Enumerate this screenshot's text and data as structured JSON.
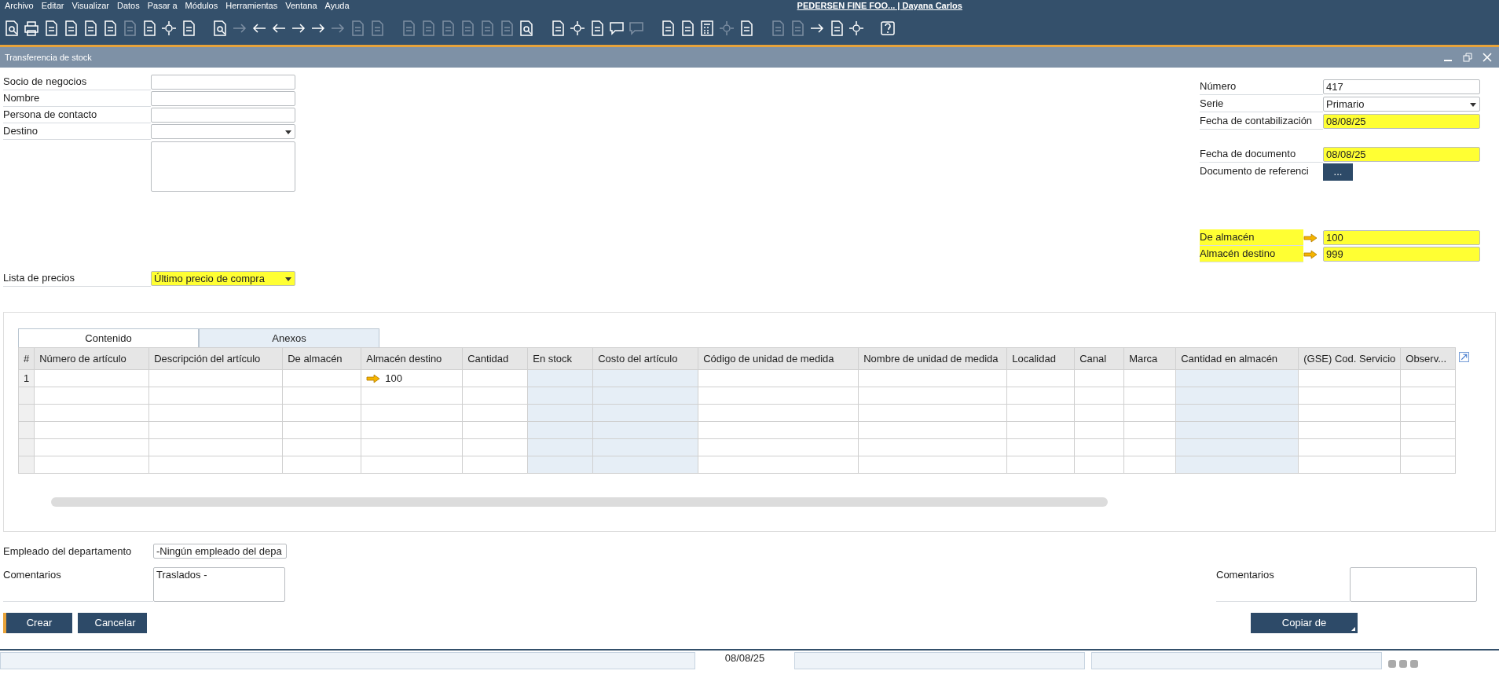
{
  "menu": [
    "Archivo",
    "Editar",
    "Visualizar",
    "Datos",
    "Pasar a",
    "Módulos",
    "Herramientas",
    "Ventana",
    "Ayuda"
  ],
  "app_title": "PEDERSEN FINE FOO... | Dayana Carlos",
  "toolbar": [
    {
      "disabled": false
    },
    {
      "disabled": false
    },
    {
      "disabled": false
    },
    {
      "disabled": false
    },
    {
      "disabled": false
    },
    {
      "disabled": false
    },
    {
      "disabled": true
    },
    {
      "disabled": false
    },
    {
      "disabled": false
    },
    {
      "disabled": false
    },
    {
      "disabled": false
    },
    {
      "disabled": true
    },
    {
      "disabled": false
    },
    {
      "disabled": false
    },
    {
      "disabled": false
    },
    {
      "disabled": false
    },
    {
      "disabled": true
    },
    {
      "disabled": true
    },
    {
      "disabled": true
    },
    {
      "disabled": true
    },
    {
      "disabled": true
    },
    {
      "disabled": true
    },
    {
      "disabled": true
    },
    {
      "disabled": true
    },
    {
      "disabled": true
    },
    {
      "disabled": false
    },
    {
      "disabled": false
    },
    {
      "disabled": false
    },
    {
      "disabled": false
    },
    {
      "disabled": false
    },
    {
      "disabled": true
    },
    {
      "disabled": false
    },
    {
      "disabled": false
    },
    {
      "disabled": false
    },
    {
      "disabled": true
    },
    {
      "disabled": false
    },
    {
      "disabled": true
    },
    {
      "disabled": true
    },
    {
      "disabled": false
    },
    {
      "disabled": false
    },
    {
      "disabled": false
    },
    {
      "disabled": false
    }
  ],
  "window": {
    "title": "Transferencia de stock"
  },
  "left_fields": [
    {
      "kind": "text",
      "label": "Socio de negocios"
    },
    {
      "kind": "text",
      "label": "Nombre"
    },
    {
      "kind": "text",
      "label": "Persona de contacto"
    },
    {
      "kind": "select",
      "label": "Destino"
    },
    {
      "kind": "textarea"
    }
  ],
  "price_list": {
    "label": "Lista de precios",
    "value": "Último precio de compra",
    "highlighted": true
  },
  "right_fields": [
    {
      "kind": "text",
      "label": "Número",
      "value": "417",
      "highlighted": false
    },
    {
      "kind": "select",
      "label": "Serie",
      "value": "Primario",
      "highlighted": false
    },
    {
      "kind": "text",
      "label": "Fecha de contabilización",
      "value": "08/08/25",
      "highlighted": true
    },
    {
      "kind": "gap"
    },
    {
      "kind": "text",
      "label": "Fecha de documento",
      "value": "08/08/25",
      "highlighted": true
    },
    {
      "kind": "button",
      "label": "Documento de referenci",
      "button": "..."
    }
  ],
  "warehouses": [
    {
      "label": "De almacén",
      "value": "100",
      "highlighted": true
    },
    {
      "label": "Almacén destino",
      "value": "999",
      "highlighted": true
    }
  ],
  "tabs": [
    {
      "label": "Contenido",
      "selected": true
    },
    {
      "label": "Anexos",
      "selected": false
    }
  ],
  "table": {
    "columns": [
      {
        "label": "#"
      },
      {
        "label": "Número de artículo",
        "shaded": false
      },
      {
        "label": "Descripción del artículo",
        "shaded": false
      },
      {
        "label": "De almacén",
        "shaded": false
      },
      {
        "label": "Almacén destino",
        "shaded": false
      },
      {
        "label": "Cantidad",
        "shaded": false
      },
      {
        "label": "En stock",
        "shaded": true
      },
      {
        "label": "Costo del artículo",
        "shaded": true
      },
      {
        "label": "Código de unidad de medida",
        "shaded": false
      },
      {
        "label": "Nombre de unidad de medida",
        "shaded": false
      },
      {
        "label": "Localidad",
        "shaded": false
      },
      {
        "label": "Canal",
        "shaded": false
      },
      {
        "label": "Marca",
        "shaded": false
      },
      {
        "label": "Cantidad en almacén",
        "shaded": true
      },
      {
        "label": "(GSE) Cod. Servicio",
        "shaded": false
      },
      {
        "label": "Observ...",
        "shaded": false
      }
    ],
    "rows": [
      {
        "number": "1",
        "target_warehouse": "100"
      }
    ]
  },
  "employee": {
    "label": "Empleado del departamento",
    "value": "-Ningún empleado del depa"
  },
  "comments_left": {
    "label": "Comentarios",
    "value": "Traslados -"
  },
  "comments_right": {
    "label": "Comentarios"
  },
  "buttons": [
    {
      "label": "Crear",
      "primary": true,
      "menu": false
    },
    {
      "label": "Cancelar",
      "primary": false,
      "menu": false
    }
  ],
  "copy_button": {
    "label": "Copiar de",
    "primary": false,
    "menu": true
  },
  "status_bar": {
    "date": "08/08/25"
  }
}
